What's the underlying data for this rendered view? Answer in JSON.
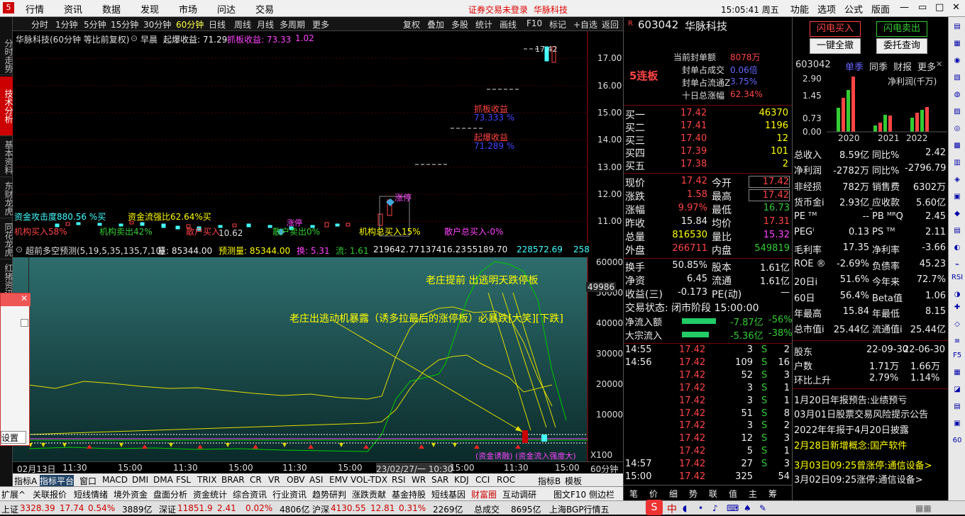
{
  "menubar": {
    "items": [
      "行情",
      "资讯",
      "数据",
      "发现",
      "市场",
      "问达",
      "交易"
    ],
    "notice": "证券交易未登录",
    "stock": "华脉科技",
    "clock": "15:05:41 周五",
    "right": [
      "功能",
      "选项",
      "公式",
      "版面"
    ]
  },
  "leftnav": [
    "分时走势",
    "技术分析",
    "基本资料",
    "东财龙虎",
    "同花龙虎",
    "红猪资讯"
  ],
  "periods": [
    "分时",
    "1分钟",
    "5分钟",
    "15分钟",
    "30分钟",
    "60分钟",
    "日线",
    "周线",
    "月线",
    "多周期",
    "更多"
  ],
  "selected_period": "60分钟",
  "tools": [
    "复权",
    "叠加",
    "多股",
    "统计",
    "画线",
    "F10",
    "标记",
    "+自选",
    "返回"
  ],
  "chart": {
    "title": "华脉科技(60分钟 等比前复权)",
    "indicator": "早晨",
    "qibao": "起爆收益: 71.29",
    "zhuaban": "抓板收益: 73.33",
    "extra": "1.02",
    "ytick": [
      "17.00",
      "16.00",
      "15.00",
      "14.00",
      "13.00",
      "12.00",
      "11.00"
    ],
    "ann_zhuaban": "抓板收益",
    "ann_zhuaban_v": "73.333 %",
    "ann_qibao": "起爆收益",
    "ann_qibao_v": "71.289 %",
    "price_tag": "10.62",
    "high_tag": "17.42",
    "zhangting": "涨停",
    "zhangting2": "涨停",
    "line1": "资金攻击度880.56 %买",
    "line1b": "资金流强比62.64%买",
    "line2a": "机构买入58%",
    "line2b": "机构卖出42%",
    "line2c": "散户买入",
    "line2d": "散户卖出0%",
    "line2e": "机构总买入15%",
    "line2f": "散户总买入-0%"
  },
  "sub": {
    "title": "超前多空预测(5,19,5,35,135,7,10)",
    "vol": "量: 85344.00",
    "pred": "预测量: 85344.00",
    "huan": "换: 5.31",
    "liu": "流: 1.61",
    "v1": "219642.77",
    "v2": "137416.23",
    "v3": "55189.70",
    "v4": "228572.69",
    "v5": "258",
    "yticks": [
      "60000",
      "50000",
      "40000",
      "30000",
      "20000",
      "10000"
    ],
    "cur": "49986",
    "ann1": "老庄提前 出逃明天跌停板",
    "ann2": "老庄出逃动机暴露（诱多拉最后的涨停板）必暴跌[大笑][下跌]",
    "bottom_ann": "(资金诱融) (资金流入强度大)",
    "x100": "X100",
    "popup_btn": "设置"
  },
  "timeaxis": [
    "02月13日",
    "11:30",
    "15:00",
    "11:30",
    "15:00",
    "11:30",
    "15:00",
    "23/02/27/一 10:30",
    "15:00",
    "11:30",
    "15:00",
    "60分钟"
  ],
  "indicators": [
    "指标A",
    "指标平台",
    "窗口",
    "MACD",
    "DMI",
    "DMA",
    "FSL",
    "TRIX",
    "BRAR",
    "CR",
    "VR",
    "OBV",
    "ASI",
    "EMV",
    "VOL-TDX",
    "RSI",
    "WR",
    "SAR",
    "KDJ",
    "CCI",
    "ROC",
    "指标B",
    "模板"
  ],
  "funcs": [
    "扩展^",
    "关联报价",
    "短线情绪",
    "境外资金",
    "盘面分析",
    "资金统计",
    "综合资讯",
    "行业资讯",
    "趋势研判",
    "涨跌贡献",
    "基金持股",
    "短线基因",
    "财富圈",
    "互动调研",
    "图文F10",
    "侧边栏"
  ],
  "status": [
    {
      "name": "上证",
      "v": "3328.39",
      "c": "17.74",
      "p": "0.54%",
      "a": "3889亿"
    },
    {
      "name": "深证",
      "v": "11851.9",
      "c": "2.41",
      "p": "0.02%",
      "a": "4806亿"
    },
    {
      "name": "沪深",
      "v": "4130.55",
      "c": "12.81",
      "p": "0.31%",
      "a": "2269亿"
    }
  ],
  "status_tail": [
    "总成交",
    "8695亿",
    "上海BGP行情五"
  ],
  "quote": {
    "code": "603042",
    "name": "华脉科技",
    "lianban": "5连板",
    "fengdan_label": "当前封单额",
    "fengdan": "8078万",
    "fengcj_label": "封单占成交",
    "fengcj": "0.06倍",
    "fengltz_label": "封单占流通Z",
    "fengltz": "3.75%",
    "shiri_label": "十日总涨幅",
    "shiri": "62.34%",
    "buy": [
      [
        "买一",
        "17.42",
        "46370"
      ],
      [
        "买二",
        "17.41",
        "1196"
      ],
      [
        "买三",
        "17.40",
        "12"
      ],
      [
        "买四",
        "17.39",
        "101"
      ],
      [
        "买五",
        "17.38",
        "2"
      ]
    ],
    "info": [
      [
        "现价",
        "17.42",
        "今开",
        "17.42"
      ],
      [
        "涨跌",
        "1.58",
        "最高",
        "17.42"
      ],
      [
        "涨幅",
        "9.97%",
        "最低",
        "16.73"
      ],
      [
        "昨收",
        "15.84",
        "均价",
        "17.31"
      ],
      [
        "总量",
        "816530",
        "量比",
        "15.32"
      ],
      [
        "外盘",
        "266711",
        "内盘",
        "549819"
      ]
    ],
    "info2": [
      [
        "换手",
        "50.85%",
        "股本",
        "1.61亿"
      ],
      [
        "净资",
        "6.45",
        "流通",
        "1.61亿"
      ],
      [
        "收益(三)",
        "-0.173",
        "PE(动)",
        "—"
      ]
    ],
    "state": "交易状态: 闭市阶段 15:00:00",
    "flow1": [
      "净流入额",
      "-7.87亿",
      "-56%"
    ],
    "flow2": [
      "大宗流入",
      "-5.36亿",
      "-38%"
    ],
    "ticks": [
      [
        "14:55",
        "17.42",
        "3",
        "S",
        "2"
      ],
      [
        "14:56",
        "17.42",
        "109",
        "S",
        "16"
      ],
      [
        "",
        "17.42",
        "52",
        "S",
        "3"
      ],
      [
        "",
        "17.42",
        "3",
        "S",
        "1"
      ],
      [
        "",
        "17.42",
        "3",
        "S",
        "1"
      ],
      [
        "",
        "17.42",
        "51",
        "S",
        "8"
      ],
      [
        "",
        "17.42",
        "3",
        "S",
        "2"
      ],
      [
        "",
        "17.42",
        "12",
        "S",
        "3"
      ],
      [
        "",
        "17.42",
        "5",
        "S",
        "1"
      ],
      [
        "14:57",
        "17.42",
        "27",
        "S",
        "3"
      ],
      [
        "15:00",
        "17.42",
        "325",
        "",
        "54"
      ]
    ],
    "bottom_tabs": [
      "笔",
      "价",
      "细",
      "势",
      "联",
      "值",
      "主",
      "筹"
    ]
  },
  "fin": {
    "btn_buy": "闪电买入",
    "btn_sell": "闪电卖出",
    "btn_all": "一键全撤",
    "btn_query": "委托查询",
    "code": "603042",
    "tabs": [
      "单季",
      "同季",
      "财报",
      "更多"
    ],
    "yl": [
      "2.90",
      "1.45",
      "0.73",
      "0.00"
    ],
    "chart_label": "净利润(千万)",
    "chart_data": {
      "type": "bar",
      "categories": [
        "2020",
        "2021",
        "2022"
      ],
      "series": [
        {
          "name": "",
          "values": [
            1.25,
            1.8,
            2.2,
            2.9
          ]
        },
        {
          "name": "",
          "values": [
            0.35,
            0.5,
            0.9,
            0.85
          ]
        },
        {
          "name": "",
          "values": [
            0.75,
            1.0,
            1.15,
            1.3
          ]
        }
      ]
    },
    "rows": [
      [
        "总收入",
        "8.59亿",
        "同比%",
        "2.42"
      ],
      [
        "净利润",
        "-2782万",
        "同比%",
        "-2796.79"
      ],
      [
        "非经损",
        "782万",
        "销售费",
        "6302万"
      ],
      [
        "货币金i",
        "2.93亿",
        "应收款",
        "5.60亿"
      ],
      [
        "PE ᵀᴹ",
        "--",
        "PB ᴹᴿQ",
        "2.45"
      ],
      [
        "PEGⁱ",
        "0.13",
        "PS ᵀᴹ",
        "2.11"
      ],
      [
        "毛利率",
        "17.35",
        "净利率",
        "-3.66"
      ],
      [
        "ROE ®",
        "-2.69%",
        "负债率",
        "45.23"
      ],
      [
        "20日i",
        "51.6%",
        "今年来",
        "72.7%"
      ],
      [
        "60日",
        "56.4%",
        "Beta值",
        "1.06"
      ],
      [
        "年最高",
        "15.84",
        "年最低",
        "8.15"
      ],
      [
        "总市值i",
        "25.44亿",
        "流通值i",
        "25.44亿"
      ]
    ],
    "holder": [
      "股东",
      "22-09-30",
      "22-06-30"
    ],
    "hu": [
      "户数",
      "1.71万",
      "1.66万"
    ],
    "rise": [
      "环比上升",
      "2.79%",
      "1.14%"
    ],
    "news": [
      "1月20日年报预告:业绩预亏",
      "03月01日股票交易风险提示公告",
      "2022年年报于4月20日披露",
      "2月28日新增概念:国产软件",
      "3月03日09:25曾涨停:通信设备>",
      "3月02日09:25涨停:通信设备>"
    ]
  },
  "ime": "中"
}
